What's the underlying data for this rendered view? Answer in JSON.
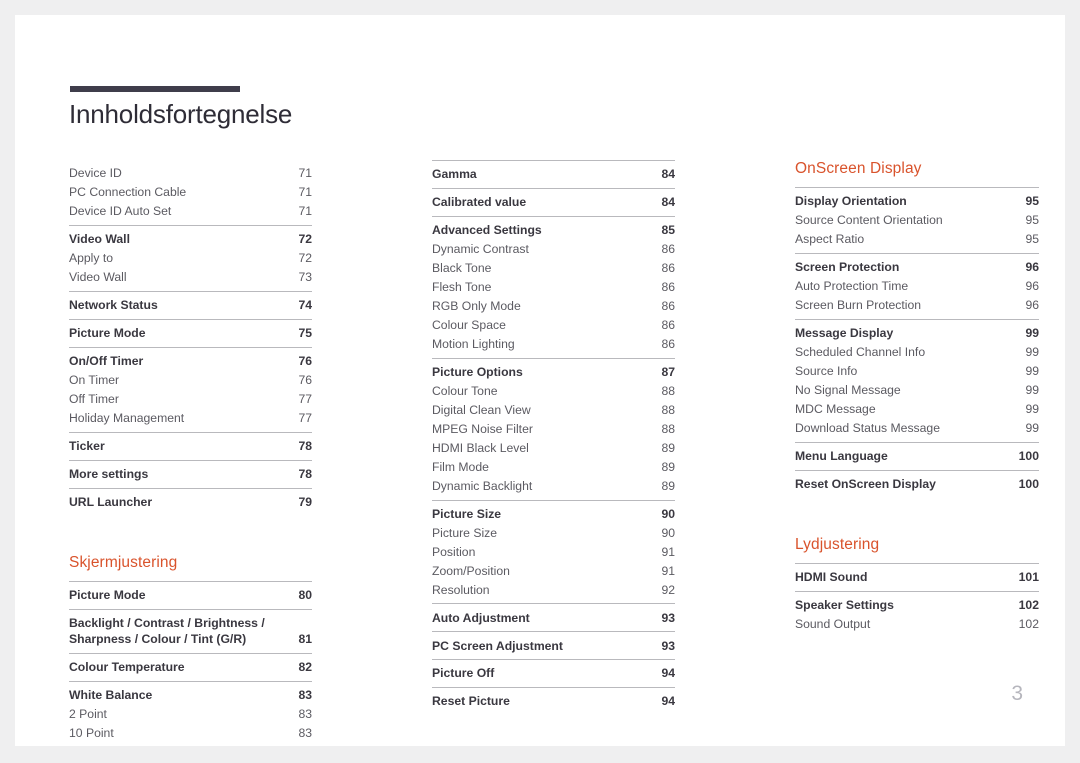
{
  "document": {
    "title": "Innholdsfortegnelse",
    "page_number": "3",
    "accent_color": "#d9532c",
    "rule_color": "#3f3d4b"
  },
  "columns": [
    {
      "name": "column-left",
      "blocks": [
        {
          "type": "group",
          "rule": false,
          "rows": [
            {
              "style": "sub",
              "label": "Device ID",
              "page": "71"
            },
            {
              "style": "sub",
              "label": "PC Connection Cable",
              "page": "71"
            },
            {
              "style": "sub",
              "label": "Device ID Auto Set",
              "page": "71"
            }
          ]
        },
        {
          "type": "group",
          "rule": true,
          "rows": [
            {
              "style": "main",
              "label": "Video Wall",
              "page": "72"
            },
            {
              "style": "sub",
              "label": "Apply to",
              "page": "72"
            },
            {
              "style": "sub",
              "label": "Video Wall",
              "page": "73"
            }
          ]
        },
        {
          "type": "group",
          "rule": true,
          "rows": [
            {
              "style": "main",
              "label": "Network Status",
              "page": "74"
            }
          ]
        },
        {
          "type": "group",
          "rule": true,
          "rows": [
            {
              "style": "main",
              "label": "Picture Mode",
              "page": "75"
            }
          ]
        },
        {
          "type": "group",
          "rule": true,
          "rows": [
            {
              "style": "main",
              "label": "On/Off Timer",
              "page": "76"
            },
            {
              "style": "sub",
              "label": "On Timer",
              "page": "76"
            },
            {
              "style": "sub",
              "label": "Off Timer",
              "page": "77"
            },
            {
              "style": "sub",
              "label": "Holiday Management",
              "page": "77"
            }
          ]
        },
        {
          "type": "group",
          "rule": true,
          "rows": [
            {
              "style": "main",
              "label": "Ticker",
              "page": "78"
            }
          ]
        },
        {
          "type": "group",
          "rule": true,
          "rows": [
            {
              "style": "main",
              "label": "More settings",
              "page": "78"
            }
          ]
        },
        {
          "type": "group",
          "rule": true,
          "rows": [
            {
              "style": "main",
              "label": "URL Launcher",
              "page": "79"
            }
          ]
        },
        {
          "type": "gap"
        },
        {
          "type": "heading",
          "label": "Skjermjustering"
        },
        {
          "type": "group",
          "rule": true,
          "rows": [
            {
              "style": "main",
              "label": "Picture Mode",
              "page": "80"
            }
          ]
        },
        {
          "type": "group",
          "rule": true,
          "rows": [
            {
              "style": "main",
              "multiline": true,
              "label": "Backlight / Contrast / Brightness /\nSharpness / Colour / Tint (G/R)",
              "page": "81"
            }
          ]
        },
        {
          "type": "group",
          "rule": true,
          "rows": [
            {
              "style": "main",
              "label": "Colour Temperature",
              "page": "82"
            }
          ]
        },
        {
          "type": "group",
          "rule": true,
          "rows": [
            {
              "style": "main",
              "label": "White Balance",
              "page": "83"
            },
            {
              "style": "sub",
              "label": "2 Point",
              "page": "83"
            },
            {
              "style": "sub",
              "label": "10 Point",
              "page": "83"
            }
          ]
        }
      ]
    },
    {
      "name": "column-middle",
      "blocks": [
        {
          "type": "group",
          "rule": true,
          "rows": [
            {
              "style": "main",
              "label": "Gamma",
              "page": "84"
            }
          ]
        },
        {
          "type": "group",
          "rule": true,
          "rows": [
            {
              "style": "main",
              "label": "Calibrated value",
              "page": "84"
            }
          ]
        },
        {
          "type": "group",
          "rule": true,
          "rows": [
            {
              "style": "main",
              "label": "Advanced Settings",
              "page": "85"
            },
            {
              "style": "sub",
              "label": "Dynamic Contrast",
              "page": "86"
            },
            {
              "style": "sub",
              "label": "Black Tone",
              "page": "86"
            },
            {
              "style": "sub",
              "label": "Flesh Tone",
              "page": "86"
            },
            {
              "style": "sub",
              "label": "RGB Only Mode",
              "page": "86"
            },
            {
              "style": "sub",
              "label": "Colour Space",
              "page": "86"
            },
            {
              "style": "sub",
              "label": "Motion Lighting",
              "page": "86"
            }
          ]
        },
        {
          "type": "group",
          "rule": true,
          "rows": [
            {
              "style": "main",
              "label": "Picture Options",
              "page": "87"
            },
            {
              "style": "sub",
              "label": "Colour Tone",
              "page": "88"
            },
            {
              "style": "sub",
              "label": "Digital Clean View",
              "page": "88"
            },
            {
              "style": "sub",
              "label": "MPEG Noise Filter",
              "page": "88"
            },
            {
              "style": "sub",
              "label": "HDMI Black Level",
              "page": "89"
            },
            {
              "style": "sub",
              "label": "Film Mode",
              "page": "89"
            },
            {
              "style": "sub",
              "label": "Dynamic Backlight",
              "page": "89"
            }
          ]
        },
        {
          "type": "group",
          "rule": true,
          "rows": [
            {
              "style": "main",
              "label": "Picture Size",
              "page": "90"
            },
            {
              "style": "sub",
              "label": "Picture Size",
              "page": "90"
            },
            {
              "style": "sub",
              "label": "Position",
              "page": "91"
            },
            {
              "style": "sub",
              "label": "Zoom/Position",
              "page": "91"
            },
            {
              "style": "sub",
              "label": "Resolution",
              "page": "92"
            }
          ]
        },
        {
          "type": "group",
          "rule": true,
          "rows": [
            {
              "style": "main",
              "label": "Auto Adjustment",
              "page": "93"
            }
          ]
        },
        {
          "type": "group",
          "rule": true,
          "rows": [
            {
              "style": "main",
              "label": "PC Screen Adjustment",
              "page": "93"
            }
          ]
        },
        {
          "type": "group",
          "rule": true,
          "rows": [
            {
              "style": "main",
              "label": "Picture Off",
              "page": "94"
            }
          ]
        },
        {
          "type": "group",
          "rule": true,
          "rows": [
            {
              "style": "main",
              "label": "Reset Picture",
              "page": "94"
            }
          ]
        }
      ]
    },
    {
      "name": "column-right",
      "blocks": [
        {
          "type": "heading",
          "label": "OnScreen Display"
        },
        {
          "type": "group",
          "rule": true,
          "rows": [
            {
              "style": "main",
              "label": "Display Orientation",
              "page": "95"
            },
            {
              "style": "sub",
              "label": "Source Content Orientation",
              "page": "95"
            },
            {
              "style": "sub",
              "label": "Aspect Ratio",
              "page": "95"
            }
          ]
        },
        {
          "type": "group",
          "rule": true,
          "rows": [
            {
              "style": "main",
              "label": "Screen Protection",
              "page": "96"
            },
            {
              "style": "sub",
              "label": "Auto Protection Time",
              "page": "96"
            },
            {
              "style": "sub",
              "label": "Screen Burn Protection",
              "page": "96"
            }
          ]
        },
        {
          "type": "group",
          "rule": true,
          "rows": [
            {
              "style": "main",
              "label": "Message Display",
              "page": "99"
            },
            {
              "style": "sub",
              "label": "Scheduled Channel Info",
              "page": "99"
            },
            {
              "style": "sub",
              "label": "Source Info",
              "page": "99"
            },
            {
              "style": "sub",
              "label": "No Signal Message",
              "page": "99"
            },
            {
              "style": "sub",
              "label": "MDC Message",
              "page": "99"
            },
            {
              "style": "sub",
              "label": "Download Status Message",
              "page": "99"
            }
          ]
        },
        {
          "type": "group",
          "rule": true,
          "rows": [
            {
              "style": "main",
              "label": "Menu Language",
              "page": "100"
            }
          ]
        },
        {
          "type": "group",
          "rule": true,
          "rows": [
            {
              "style": "main",
              "label": "Reset OnScreen Display",
              "page": "100"
            }
          ]
        },
        {
          "type": "gap"
        },
        {
          "type": "heading",
          "label": "Lydjustering"
        },
        {
          "type": "group",
          "rule": true,
          "rows": [
            {
              "style": "main",
              "label": "HDMI Sound",
              "page": "101"
            }
          ]
        },
        {
          "type": "group",
          "rule": true,
          "rows": [
            {
              "style": "main",
              "label": "Speaker Settings",
              "page": "102"
            },
            {
              "style": "sub",
              "label": "Sound Output",
              "page": "102"
            }
          ]
        }
      ]
    }
  ]
}
